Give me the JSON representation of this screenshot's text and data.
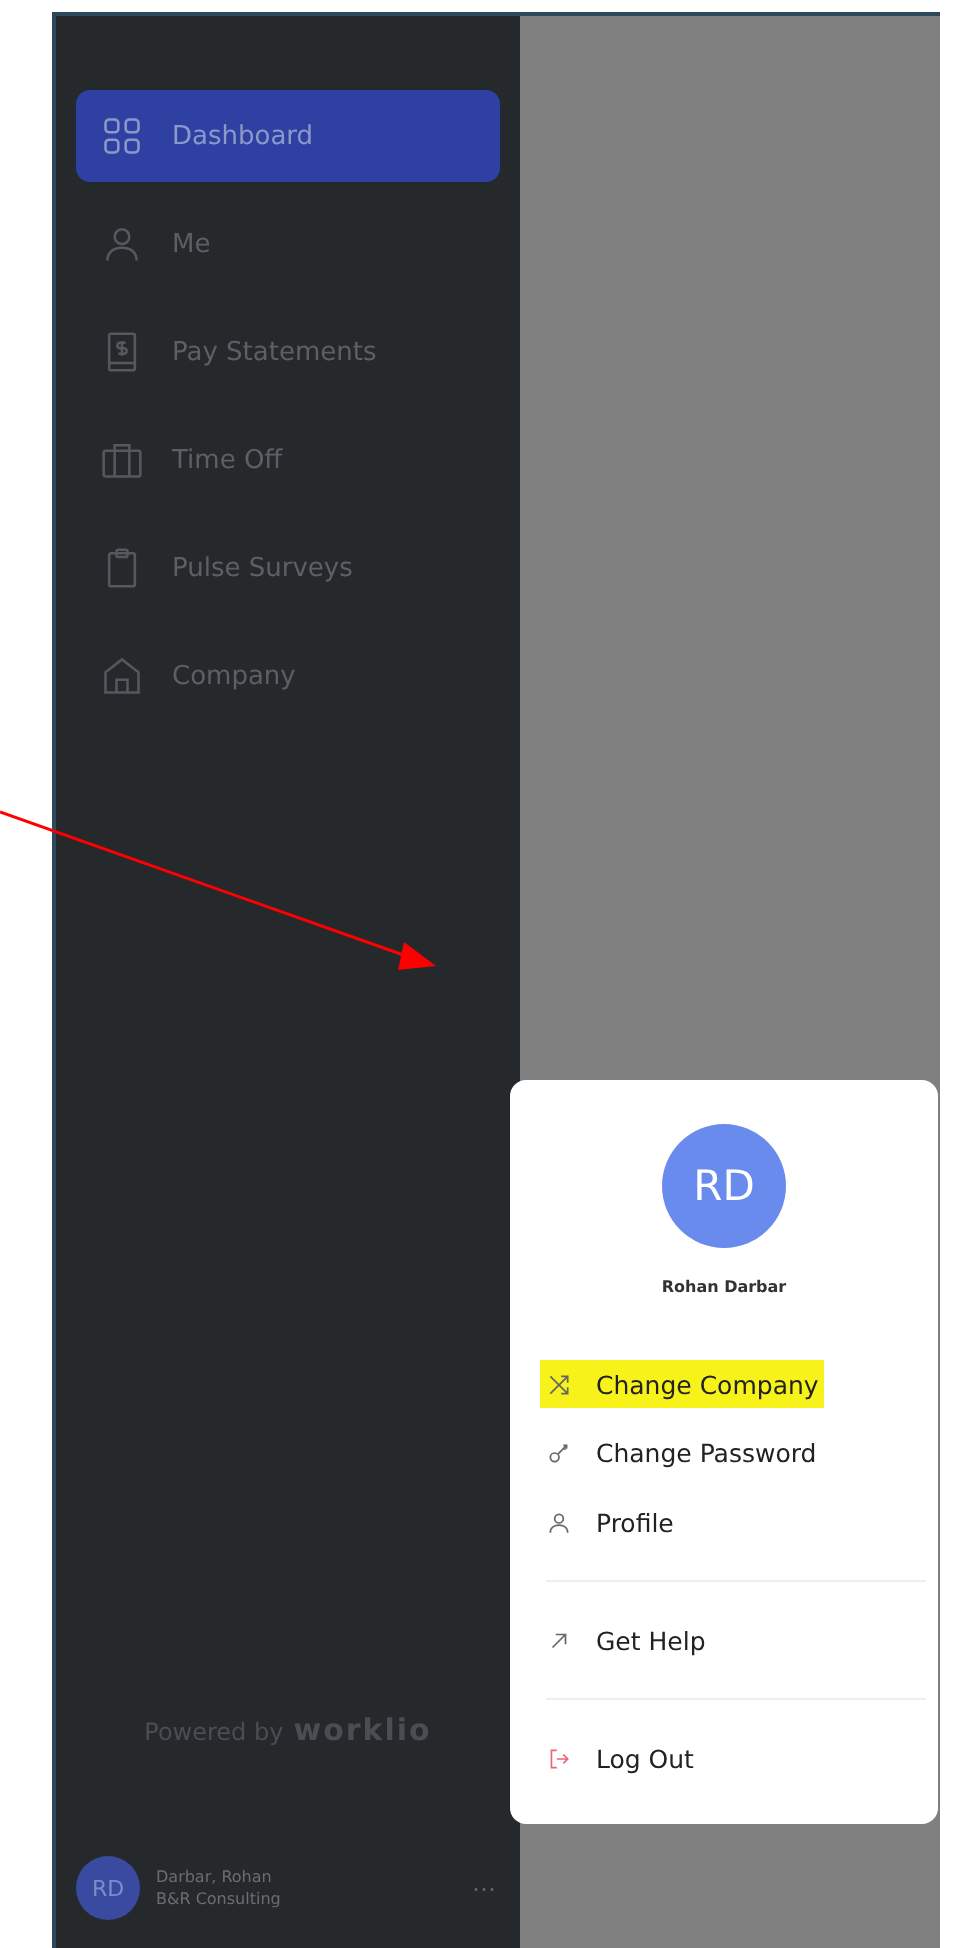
{
  "sidebar": {
    "items": [
      {
        "label": "Dashboard",
        "selected": true
      },
      {
        "label": "Me",
        "selected": false
      },
      {
        "label": "Pay Statements",
        "selected": false
      },
      {
        "label": "Time Off",
        "selected": false
      },
      {
        "label": "Pulse Surveys",
        "selected": false
      },
      {
        "label": "Company",
        "selected": false
      }
    ],
    "powered_by": {
      "text": "Powered by",
      "brand": "worklio"
    },
    "account": {
      "initials": "RD",
      "name": "Darbar, Rohan",
      "company": "B&R Consulting",
      "menu_button": "···"
    }
  },
  "user_menu": {
    "initials": "RD",
    "name": "Rohan Darbar",
    "groups": [
      {
        "items": [
          {
            "label": "Change Company",
            "highlighted": true
          },
          {
            "label": "Change Password",
            "highlighted": false
          },
          {
            "label": "Profile",
            "highlighted": false
          }
        ]
      },
      {
        "items": [
          {
            "label": "Get Help",
            "highlighted": false
          }
        ]
      },
      {
        "items": [
          {
            "label": "Log Out",
            "highlighted": false
          }
        ]
      }
    ]
  }
}
